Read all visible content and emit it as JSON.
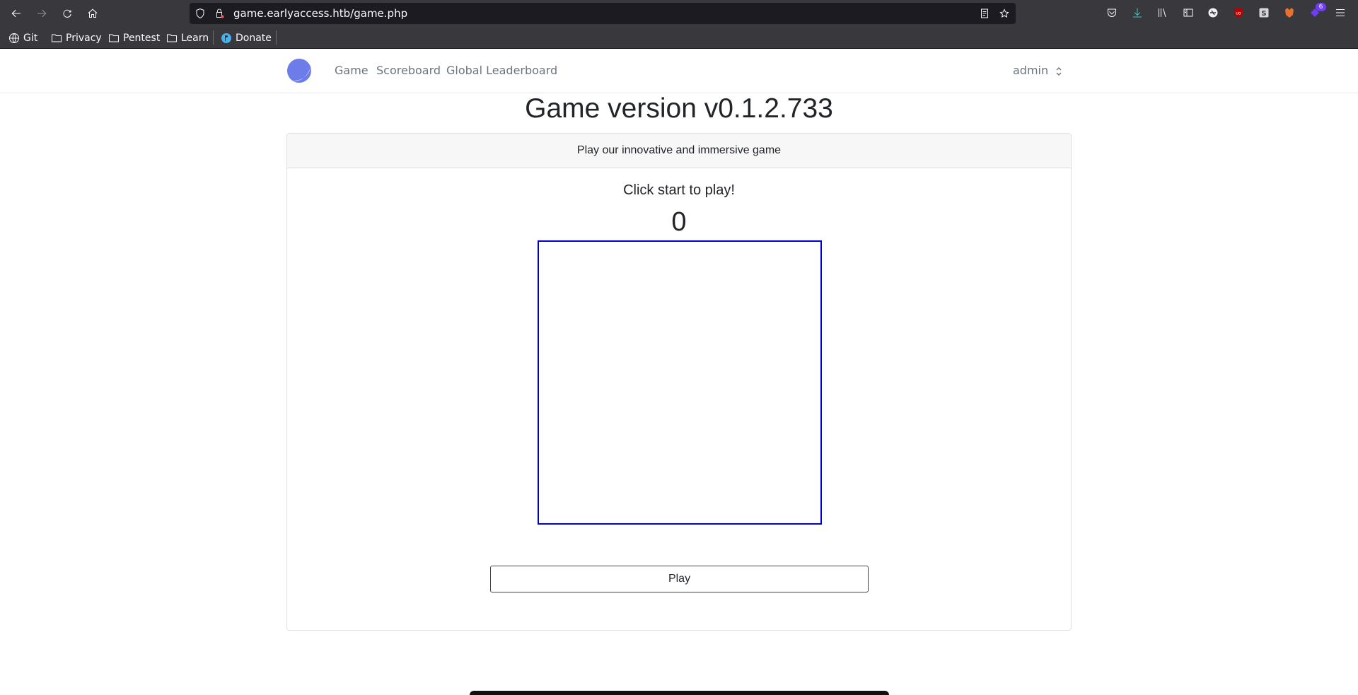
{
  "browser": {
    "url": "game.earlyaccess.htb/game.php",
    "extension_badge": "6"
  },
  "bookmarks": [
    {
      "label": "Git",
      "icon": "globe-icon"
    },
    {
      "label": "Privacy",
      "icon": "folder-icon"
    },
    {
      "label": "Pentest",
      "icon": "folder-icon"
    },
    {
      "label": "Learn",
      "icon": "folder-icon"
    },
    {
      "label": "Donate",
      "icon": "donate-icon"
    }
  ],
  "site": {
    "nav": [
      "Game",
      "Scoreboard",
      "Global Leaderboard"
    ],
    "user": "admin"
  },
  "main": {
    "title": "Game version v0.1.2.733",
    "card_header": "Play our innovative and immersive game",
    "prompt": "Click start to play!",
    "score": "0",
    "play_label": "Play"
  },
  "colors": {
    "accent": "#6c7ce8",
    "canvas_border": "#0000cc",
    "toolbar": "#38383d"
  }
}
